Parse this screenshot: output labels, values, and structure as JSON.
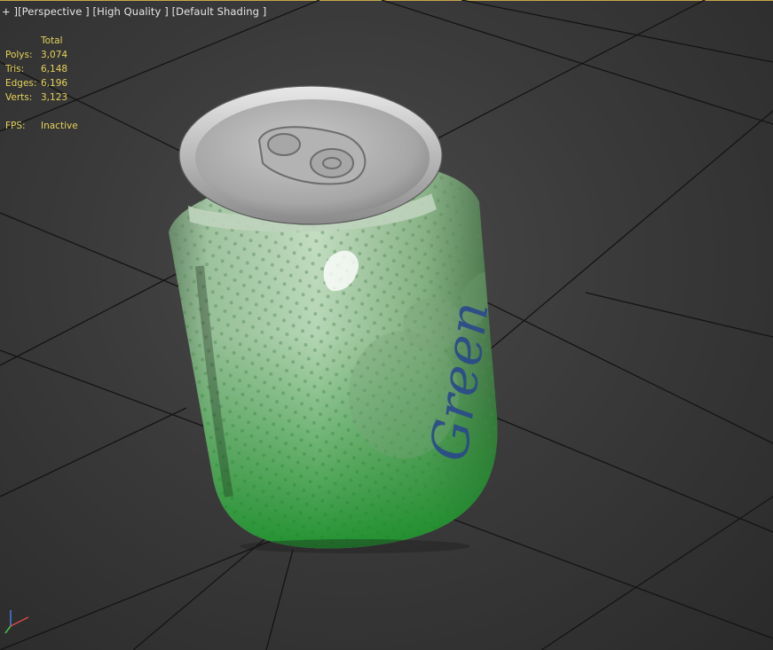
{
  "viewport": {
    "labels": {
      "plus": "+ ]",
      "view": "[Perspective ]",
      "quality": "[High Quality ]",
      "shading": "[Default Shading ]"
    },
    "stats": {
      "header": "Total",
      "polys_label": "Polys:",
      "polys": "3,074",
      "tris_label": "Tris:",
      "tris": "6,148",
      "edges_label": "Edges:",
      "edges": "6,196",
      "verts_label": "Verts:",
      "verts": "3,123",
      "fps_label": "FPS:",
      "fps": "Inactive"
    }
  },
  "can": {
    "label": "Green",
    "body_color": "#2f9a3a",
    "label_color": "#2a4a8a",
    "lid_color": "#bdbdbd"
  },
  "colors": {
    "stats_text": "#e6d25a",
    "viewport_border": "#c8a64a",
    "grid": "#151515"
  }
}
